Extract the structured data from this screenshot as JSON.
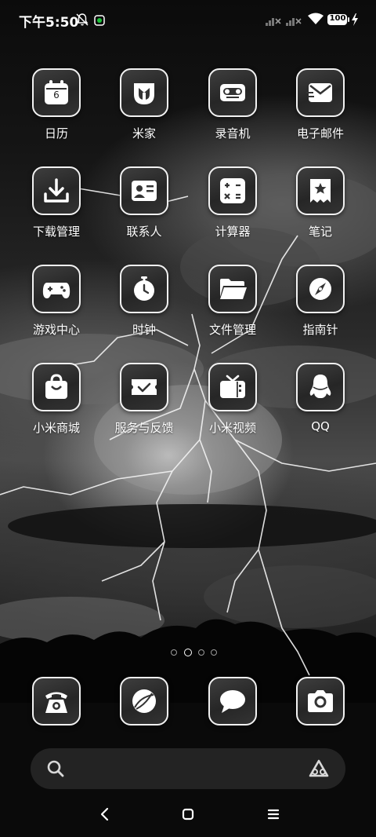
{
  "status_bar": {
    "time": "下午5:50",
    "battery": "100",
    "icons": [
      "alarm-off-icon",
      "app-notification-icon",
      "signal-icon",
      "signal-icon",
      "wifi-icon",
      "battery-icon",
      "charging-icon"
    ]
  },
  "apps": [
    {
      "label": "日历",
      "icon": "calendar-icon",
      "badge": "6"
    },
    {
      "label": "米家",
      "icon": "mijia-icon"
    },
    {
      "label": "录音机",
      "icon": "recorder-icon"
    },
    {
      "label": "电子邮件",
      "icon": "email-icon"
    },
    {
      "label": "下载管理",
      "icon": "download-icon"
    },
    {
      "label": "联系人",
      "icon": "contacts-icon"
    },
    {
      "label": "计算器",
      "icon": "calculator-icon"
    },
    {
      "label": "笔记",
      "icon": "notes-icon"
    },
    {
      "label": "游戏中心",
      "icon": "gamepad-icon"
    },
    {
      "label": "时钟",
      "icon": "clock-icon"
    },
    {
      "label": "文件管理",
      "icon": "folder-icon"
    },
    {
      "label": "指南针",
      "icon": "compass-icon"
    },
    {
      "label": "小米商城",
      "icon": "shopping-bag-icon"
    },
    {
      "label": "服务与反馈",
      "icon": "service-feedback-icon"
    },
    {
      "label": "小米视频",
      "icon": "tv-icon"
    },
    {
      "label": "QQ",
      "icon": "qq-penguin-icon"
    }
  ],
  "pager": {
    "pages": 4,
    "current_index": 1
  },
  "dock": [
    {
      "icon": "phone-icon"
    },
    {
      "icon": "browser-icon"
    },
    {
      "icon": "message-icon"
    },
    {
      "icon": "camera-icon"
    }
  ],
  "search": {
    "left_icon": "search-icon",
    "right_icon": "assistant-icon"
  },
  "nav_bar": [
    "back-icon",
    "home-icon",
    "menu-icon"
  ]
}
